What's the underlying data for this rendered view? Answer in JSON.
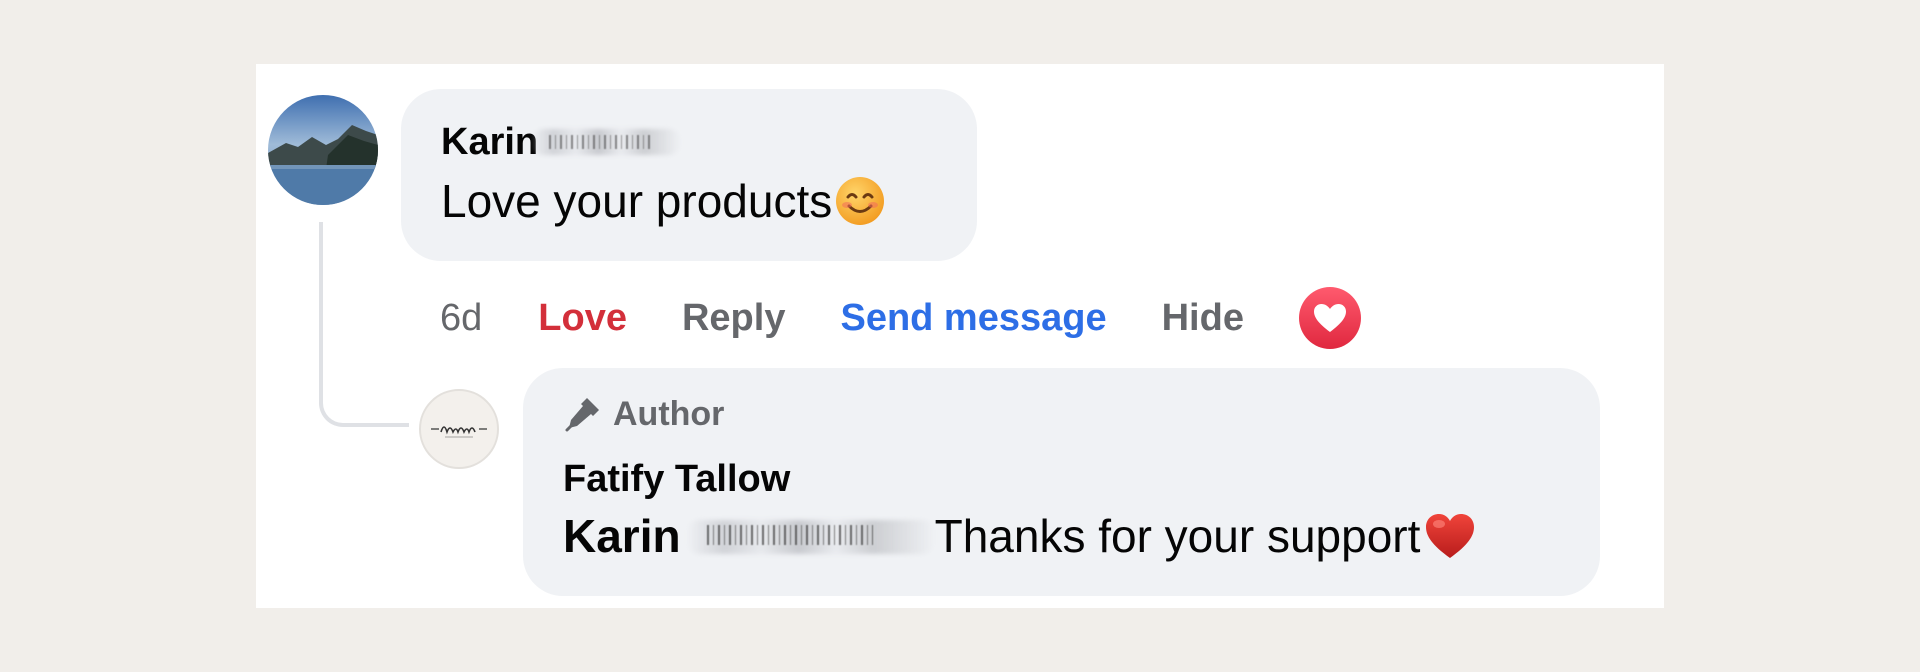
{
  "comment": {
    "author_first_name": "Karin",
    "text": "Love your products",
    "emoji": "smiling-face-emoji"
  },
  "actions": {
    "time": "6d",
    "love_label": "Love",
    "reply_label": "Reply",
    "send_message_label": "Send message",
    "hide_label": "Hide",
    "reaction_icon": "heart-reaction-icon"
  },
  "reply": {
    "badge_label": "Author",
    "badge_icon": "pen-icon",
    "page_name": "Fatify Tallow",
    "mention": "Karin",
    "text": "Thanks for your support",
    "emoji": "red-heart-emoji"
  },
  "colors": {
    "love": "#d32f3a",
    "send_message": "#2d6ee6",
    "secondary_text": "#65676b",
    "bubble": "#f0f2f5"
  }
}
